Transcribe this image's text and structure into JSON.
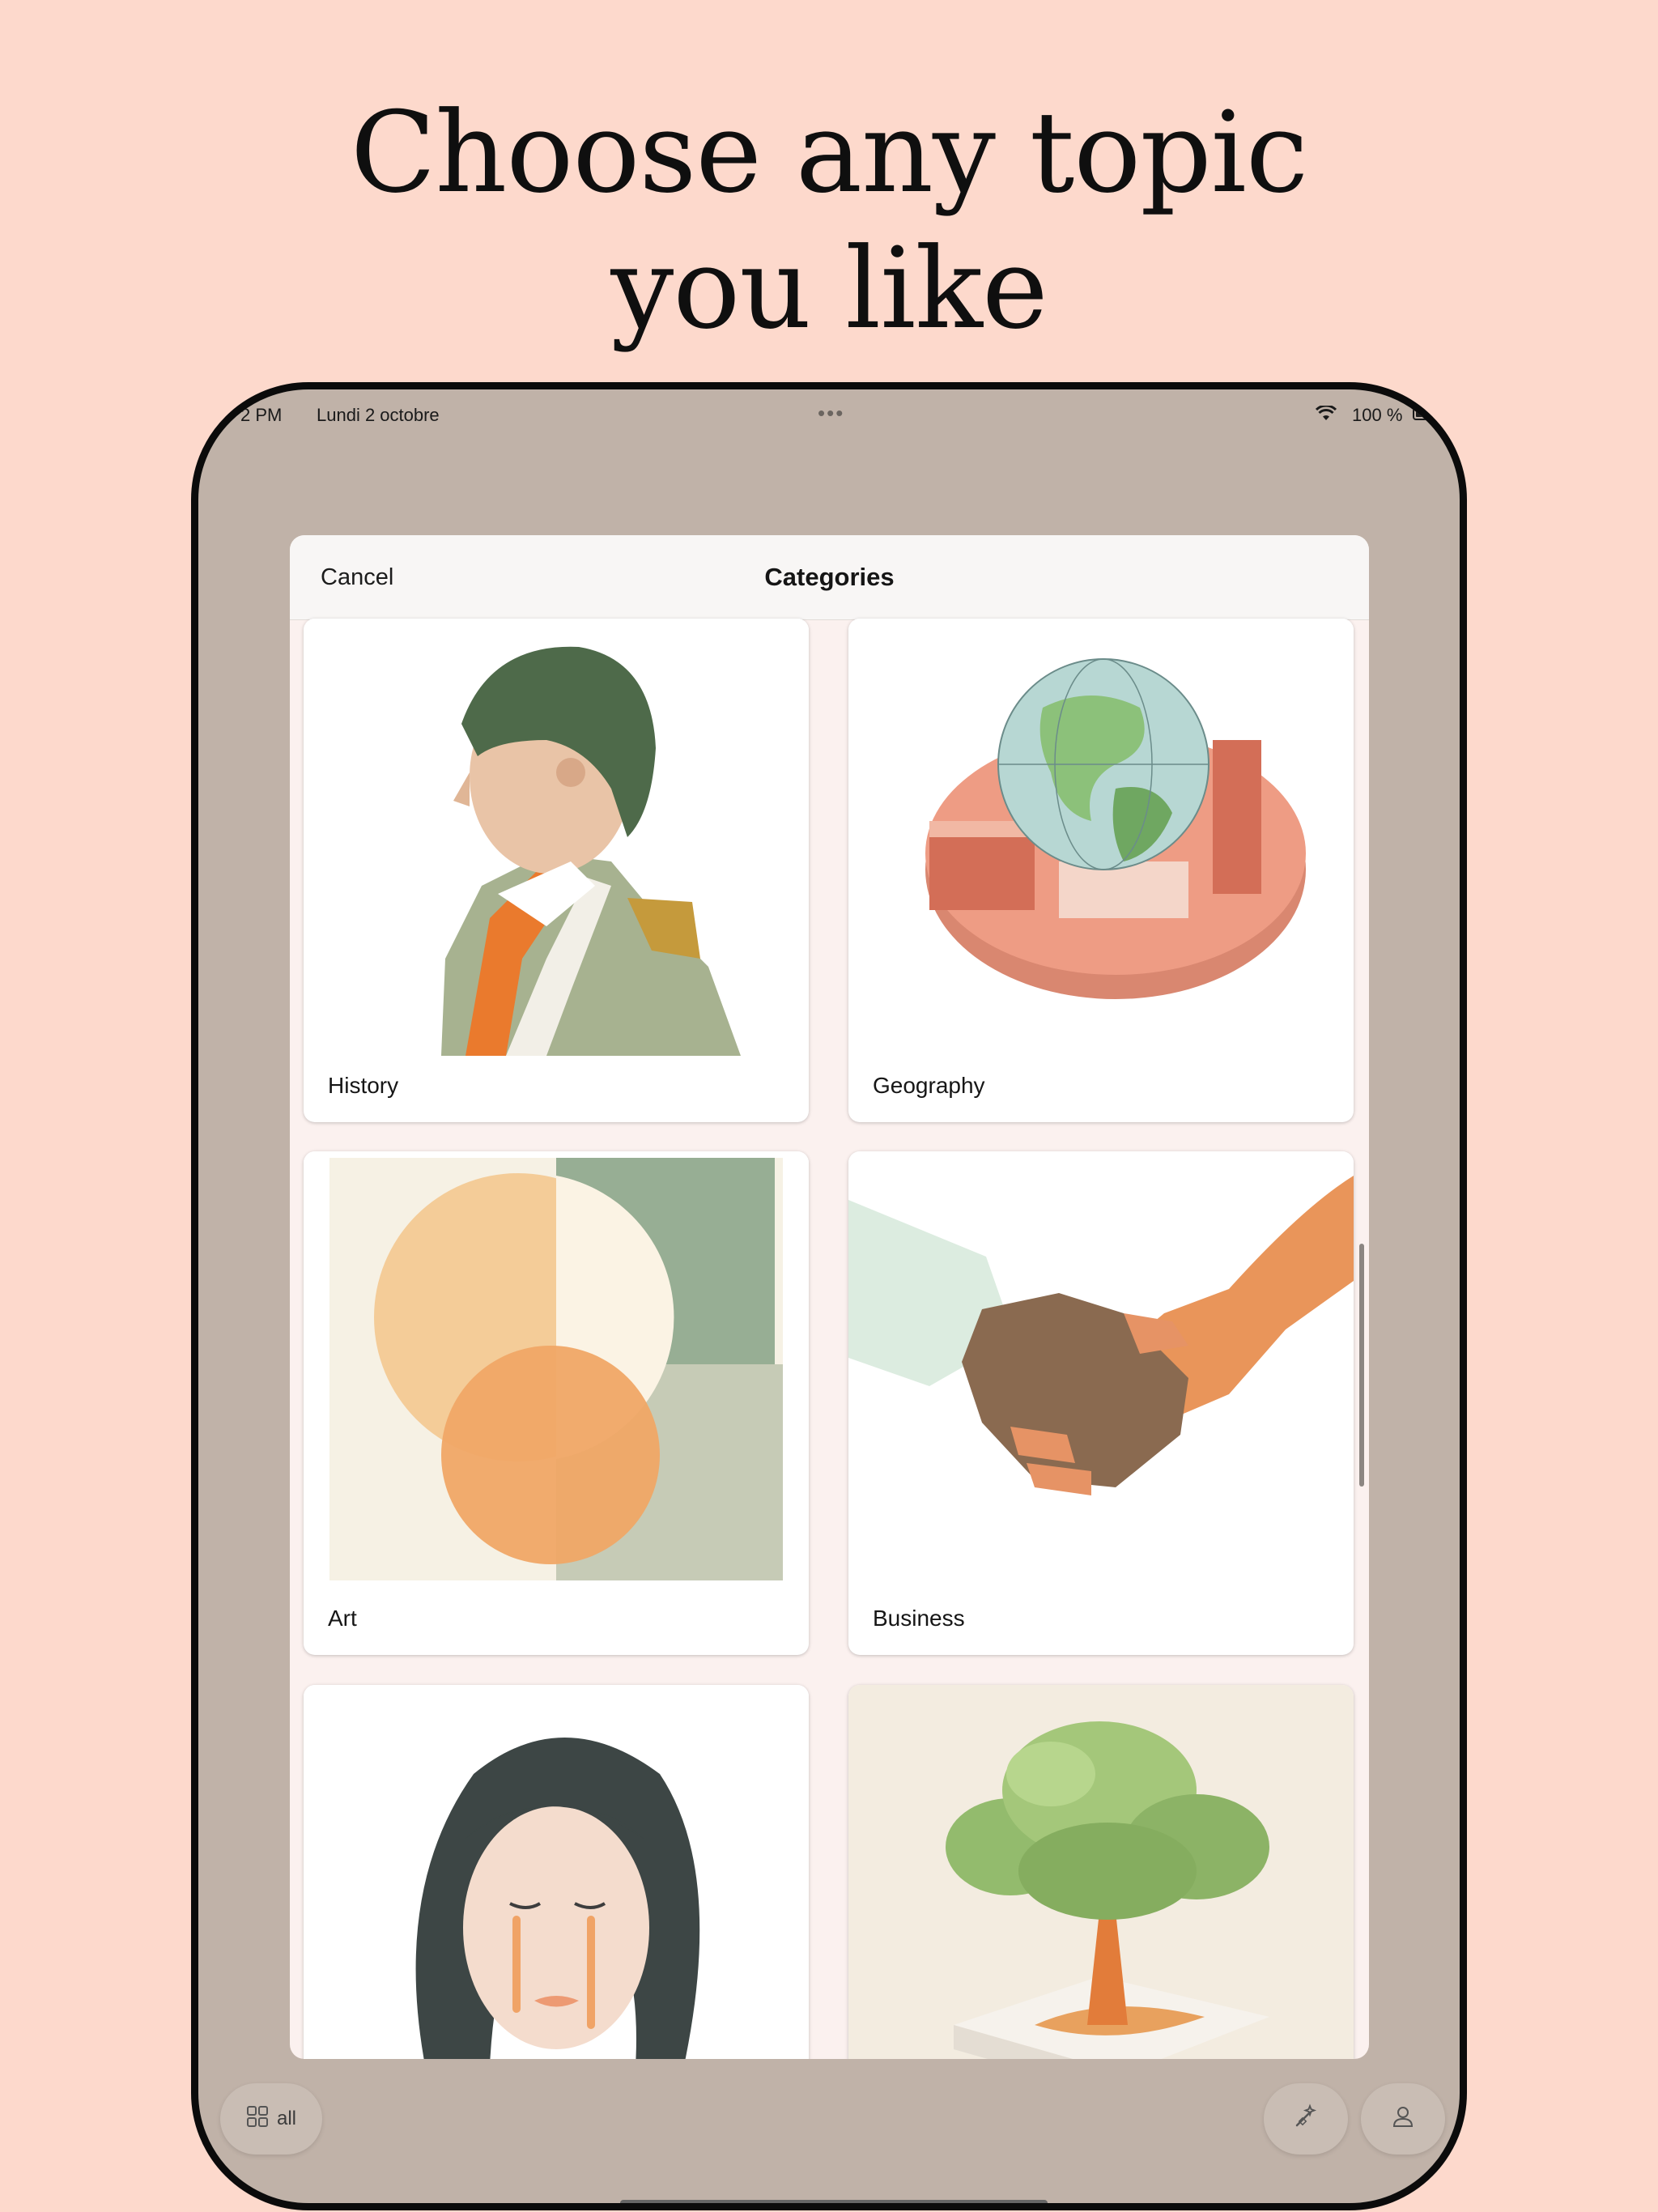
{
  "headline": {
    "line1": "Choose any topic",
    "line2": "you like"
  },
  "status_bar": {
    "time": "2 PM",
    "date": "Lundi 2 octobre",
    "multitask_dots": "•••",
    "wifi_icon": "wifi-icon",
    "battery": "100 %"
  },
  "sheet": {
    "cancel_label": "Cancel",
    "title": "Categories",
    "categories": [
      {
        "label": "History"
      },
      {
        "label": "Geography"
      },
      {
        "label": "Art"
      },
      {
        "label": "Business"
      },
      {
        "label": ""
      },
      {
        "label": ""
      }
    ]
  },
  "toolbar": {
    "all_label": "all",
    "all_icon": "grid-icon",
    "tools_icon": "wand-icon",
    "profile_icon": "person-icon"
  },
  "colors": {
    "background": "#fdd9cc",
    "device_bezel": "#0b0b0b",
    "device_screen": "#c0b2a8",
    "sheet": "#fbf1ef"
  }
}
